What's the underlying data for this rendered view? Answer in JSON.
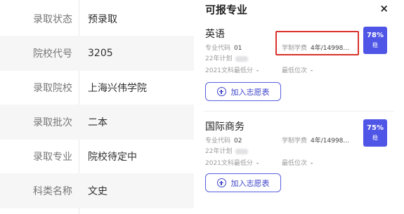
{
  "info": [
    {
      "label": "录取状态",
      "value": "预录取"
    },
    {
      "label": "院校代号",
      "value": "3205"
    },
    {
      "label": "录取院校",
      "value": "上海兴伟学院"
    },
    {
      "label": "录取批次",
      "value": "二本"
    },
    {
      "label": "录取专业",
      "value": "院校待定中"
    },
    {
      "label": "科类名称",
      "value": "文史"
    }
  ],
  "panel": {
    "title": "可报专业",
    "close": "×"
  },
  "majors": [
    {
      "name": "英语",
      "code_label": "专业代码",
      "code": "01",
      "plan_label": "22年计划",
      "min_score_label": "2021文科最低分",
      "min_score": "-",
      "min_rank_label": "最低位次",
      "min_rank": "-",
      "duration_fee_label": "学制学费",
      "duration_fee": "4年/14998...",
      "score_pct": "78%",
      "score_tag": "稳",
      "add_label": "加入志愿表"
    },
    {
      "name": "国际商务",
      "code_label": "专业代码",
      "code": "02",
      "plan_label": "22年计划",
      "min_score_label": "2021文科最低分",
      "min_score": "-",
      "min_rank_label": "最低位次",
      "min_rank": "-",
      "duration_fee_label": "学制学费",
      "duration_fee": "4年/14998...",
      "score_pct": "75%",
      "score_tag": "稳",
      "add_label": "加入志愿表"
    }
  ],
  "colors": {
    "accent": "#4f55e6",
    "highlight": "#d8322a",
    "row_shade": "#f6f6f7"
  }
}
